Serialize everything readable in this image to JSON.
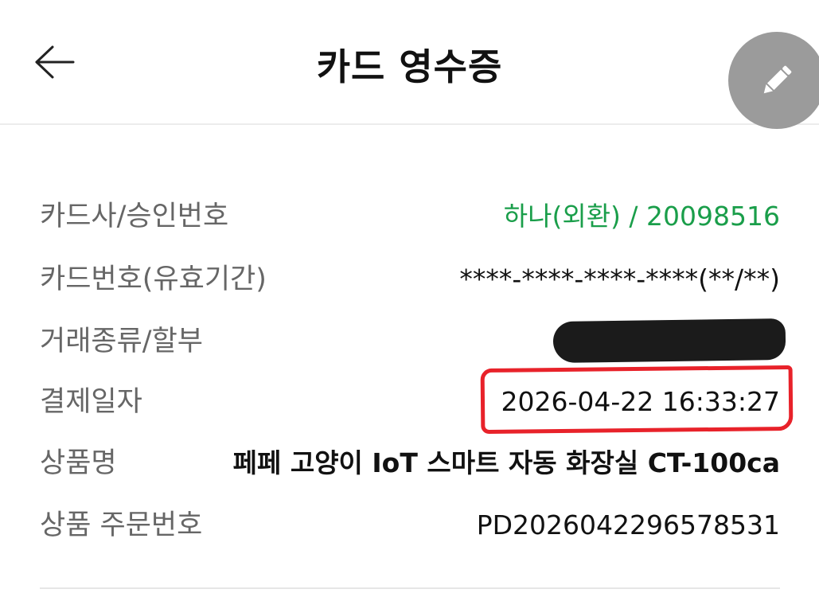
{
  "header": {
    "title": "카드 영수증"
  },
  "icons": {
    "back": "arrow-left-icon",
    "edit": "pencil-icon"
  },
  "colors": {
    "accent_green": "#1a9e4a",
    "highlight_red": "#e8222a",
    "fab_gray": "#9b9b9b",
    "label_gray": "#666666"
  },
  "receipt": {
    "rows": [
      {
        "label": "카드사/승인번호",
        "value": "하나(외환) / 20098516"
      },
      {
        "label": "카드번호(유효기간)",
        "value": "****-****-****-****(**/**)"
      },
      {
        "label": "거래종류/할부",
        "value": ""
      },
      {
        "label": "결제일자",
        "value": "2026-04-22 16:33:27"
      },
      {
        "label": "상품명",
        "value": "페페 고양이 IoT 스마트 자동 화장실 CT-100ca"
      },
      {
        "label": "상품 주문번호",
        "value": "PD2026042296578531"
      }
    ]
  }
}
